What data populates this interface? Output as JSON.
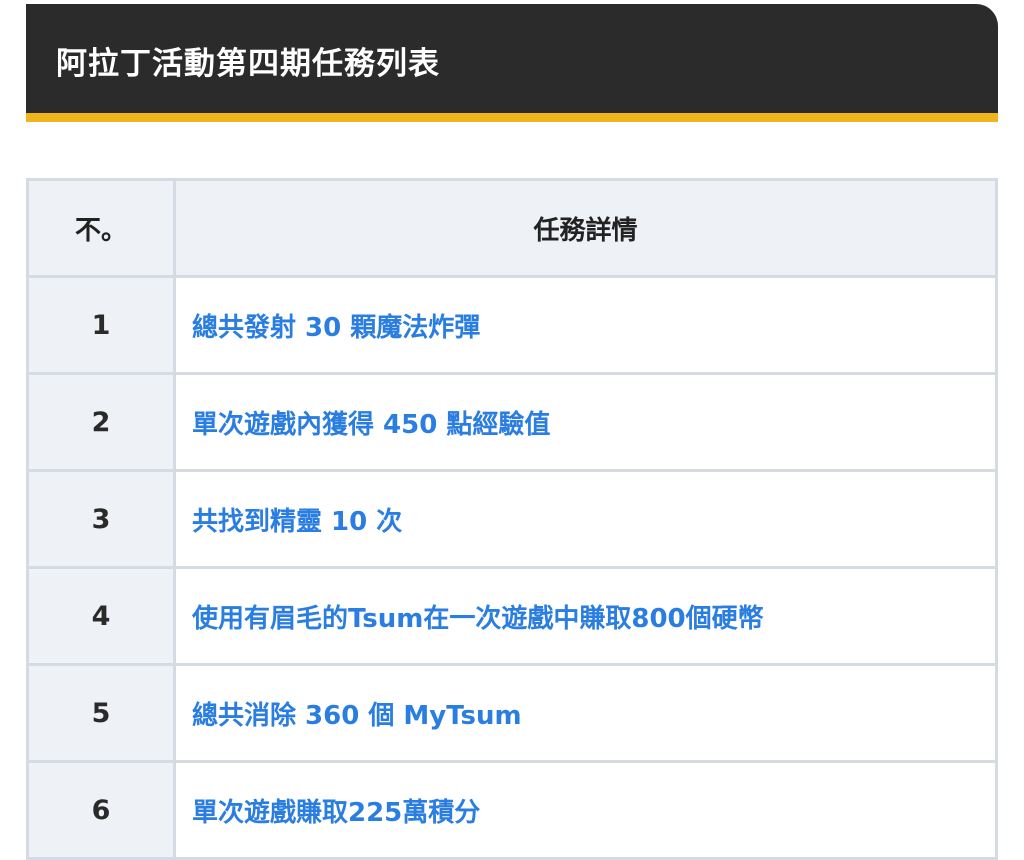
{
  "header": {
    "title": "阿拉丁活動第四期任務列表"
  },
  "table": {
    "columns": [
      "不。",
      "任務詳情"
    ],
    "rows": [
      {
        "no": "1",
        "detail": "總共發射 30 顆魔法炸彈"
      },
      {
        "no": "2",
        "detail": "單次遊戲內獲得 450 點經驗值"
      },
      {
        "no": "3",
        "detail": "共找到精靈 10 次"
      },
      {
        "no": "4",
        "detail": "使用有眉毛的Tsum在一次遊戲中賺取800個硬幣"
      },
      {
        "no": "5",
        "detail": "總共消除 360 個 MyTsum"
      },
      {
        "no": "6",
        "detail": "單次遊戲賺取225萬積分"
      }
    ]
  },
  "colors": {
    "header_bg": "#2b2b2b",
    "header_accent": "#f0b51c",
    "link": "#2a7de1",
    "cell_shade": "#eef1f6",
    "border": "#d6dbe3"
  }
}
